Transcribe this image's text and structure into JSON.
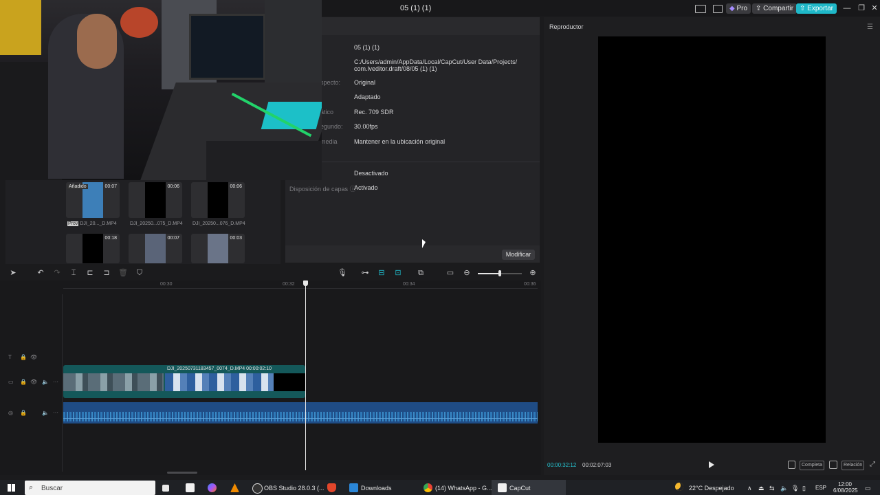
{
  "title_bar": {
    "project_title": "05 (1) (1)",
    "pro_label": "Pro",
    "share_label": "Compartir",
    "export_label": "Exportar",
    "minimize": "—",
    "restore": "❐",
    "close": "✕"
  },
  "details": {
    "rows": [
      {
        "label": "",
        "value": "05 (1) (1)"
      },
      {
        "label": "",
        "value": "C:/Users/admin/AppData/Local/CapCut/User Data/Projects/"
      },
      {
        "label": "",
        "value": "com.lveditor.draft/08/05 (1) (1)"
      },
      {
        "label": "specto:",
        "value": "Original"
      },
      {
        "label": "",
        "value": "Adaptado"
      },
      {
        "label": "ático",
        "value": "Rec. 709 SDR"
      },
      {
        "label": "egundo:",
        "value": "30.00fps"
      },
      {
        "label": "media",
        "value": "Mantener en la ubicación original"
      },
      {
        "label": "",
        "value": "Desactivado"
      },
      {
        "label": "Disposición de capas",
        "value": "Activado"
      }
    ],
    "modify_label": "Modificar"
  },
  "media": {
    "items": [
      {
        "badge": "Añadido",
        "duration": "00:07",
        "name": "DJI_20..._D.MP4",
        "tag": "Prov"
      },
      {
        "badge": "",
        "duration": "00:06",
        "name": "DJI_20250...075_D.MP4",
        "tag": ""
      },
      {
        "badge": "",
        "duration": "00:06",
        "name": "DJI_20250...076_D.MP4",
        "tag": ""
      },
      {
        "badge": "",
        "duration": "00:18",
        "name": "",
        "tag": ""
      },
      {
        "badge": "",
        "duration": "00:07",
        "name": "",
        "tag": ""
      },
      {
        "badge": "",
        "duration": "00:03",
        "name": "",
        "tag": ""
      }
    ]
  },
  "player": {
    "title": "Reproductor",
    "current_time": "00:00:32:12",
    "total_time": "00:02:07:03",
    "complete_label": "Completa",
    "ratio_label": "Relación"
  },
  "timeline": {
    "ticks": [
      "00:30",
      "00:32",
      "00:34",
      "00:36"
    ],
    "clip_label": "DJI_20250731183457_0074_D.MP4    00:00:02:10"
  },
  "taskbar": {
    "search_placeholder": "Buscar",
    "apps": [
      {
        "label": "OBS Studio 28.0.3 (...",
        "icon": "obs-icon"
      },
      {
        "label": "Downloads",
        "icon": "download-icon"
      },
      {
        "label": "(14) WhatsApp - G...",
        "icon": "chrome-icon"
      },
      {
        "label": "CapCut",
        "icon": "capcut-icon"
      }
    ],
    "weather": "22°C  Despejado",
    "language": "ESP",
    "time": "12:00",
    "date": "6/08/2025"
  },
  "colors": {
    "accent": "#1fb8c8",
    "clip": "#14585a",
    "audio": "#1f4c85",
    "background": "#1b1b1d"
  }
}
